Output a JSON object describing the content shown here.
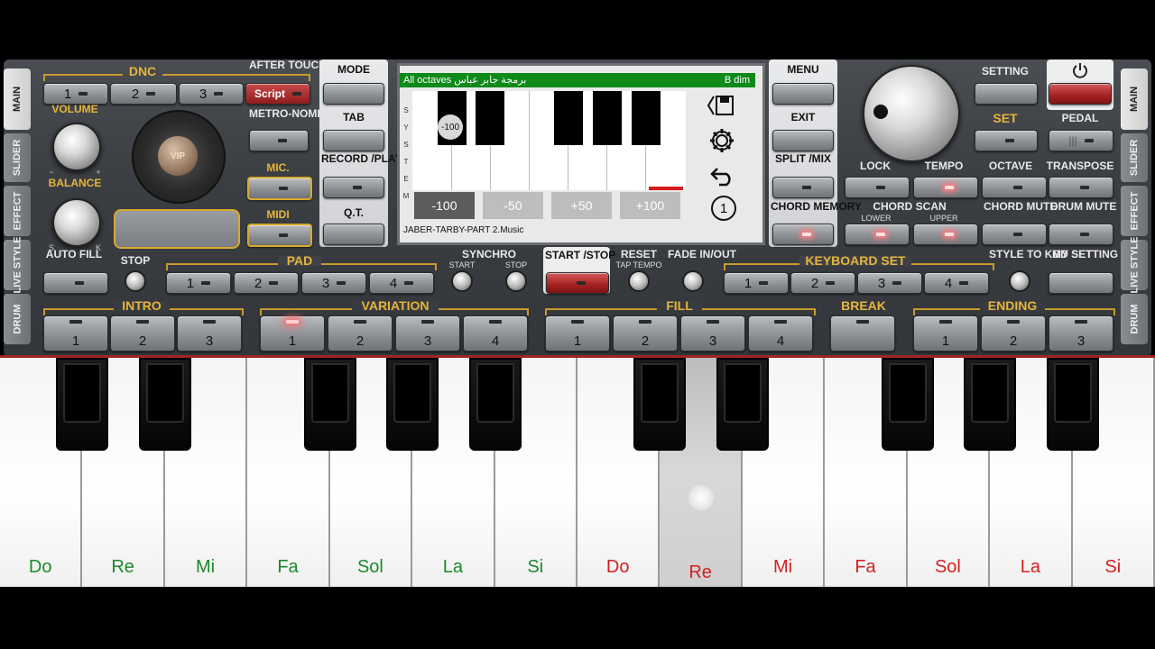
{
  "tabs": {
    "left": [
      "MAIN",
      "SLIDER",
      "EFFECT",
      "LIVE STYLE",
      "DRUM"
    ],
    "right": [
      "MAIN",
      "SLIDER",
      "EFFECT",
      "LIVE STYLE",
      "DRUM"
    ]
  },
  "top_left": {
    "dnc": "DNC",
    "dnc_buttons": [
      "1",
      "2",
      "3"
    ],
    "script": "Script",
    "after_touch": "AFTER TOUCH",
    "volume": "VOLUME",
    "balance": "BALANCE",
    "metronome": "METRO-NOME",
    "mic": "MIC.",
    "midi": "MIDI",
    "auto_fill": "AUTO FILL",
    "stop": "STOP",
    "pad": "PAD",
    "pad_buttons": [
      "1",
      "2",
      "3",
      "4"
    ],
    "vip": "VIP",
    "s": "S",
    "k": "K",
    "minus": "−",
    "plus": "+"
  },
  "center_left": {
    "mode": "MODE",
    "tab": "TAB",
    "record_play": "RECORD /PLAY",
    "qt": "Q.T."
  },
  "center_right": {
    "menu": "MENU",
    "exit": "EXIT",
    "split_mix": "SPLIT /MIX",
    "chord_memory": "CHORD MEMORY"
  },
  "screen": {
    "header_left": "All octaves برمجة جابر عباس",
    "header_right": "B dim",
    "side_letters": [
      "S",
      "Y",
      "S",
      "T",
      "E",
      "M"
    ],
    "badge": "-100",
    "buttons": [
      "-100",
      "-50",
      "+50",
      "+100"
    ],
    "footer": "JABER-TARBY-PART 2.Music",
    "icons": [
      "save-icon",
      "settings-icon",
      "undo-icon",
      "number-one-icon"
    ],
    "one": "1"
  },
  "top_right": {
    "setting": "SETTING",
    "set": "SET",
    "pedal": "PEDAL",
    "lock": "LOCK",
    "tempo": "TEMPO",
    "octave": "OCTAVE",
    "transpose": "TRANSPOSE",
    "chord_scan": "CHORD SCAN",
    "lower": "LOWER",
    "upper": "UPPER",
    "chord_mute": "CHORD MUTE",
    "drum_mute": "DRUM MUTE",
    "power_icon": "power-icon"
  },
  "middle_row": {
    "synchro": "SYNCHRO",
    "start": "START",
    "stop": "STOP",
    "start_stop": "START /STOP",
    "reset": "RESET",
    "tap_tempo": "TAP TEMPO",
    "fade": "FADE IN/OUT",
    "keyboard_set": "KEYBOARD SET",
    "keyboard_buttons": [
      "1",
      "2",
      "3",
      "4"
    ],
    "style_to_kbd": "STYLE TO KBD SET",
    "my_setting": "MY SETTING"
  },
  "bottom_row": {
    "intro": "INTRO",
    "intro_buttons": [
      "1",
      "2",
      "3"
    ],
    "variation": "VARIATION",
    "variation_buttons": [
      "1",
      "2",
      "3",
      "4"
    ],
    "fill": "FILL",
    "fill_buttons": [
      "1",
      "2",
      "3",
      "4"
    ],
    "break": "BREAK",
    "ending": "ENDING",
    "ending_buttons": [
      "1",
      "2",
      "3"
    ]
  },
  "keyboard": {
    "notes": [
      "Do",
      "Re",
      "Mi",
      "Fa",
      "Sol",
      "La",
      "Si",
      "Do",
      "Re",
      "Mi",
      "Fa",
      "Sol",
      "La",
      "Si"
    ],
    "colors": {
      "first_octave": "#1a8a2a",
      "second_octave": "#d42020"
    },
    "pressed_key_index": 8
  }
}
